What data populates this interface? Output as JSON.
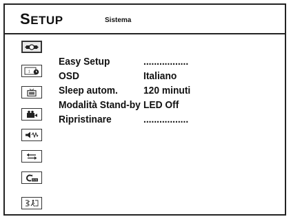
{
  "header": {
    "title_cap": "S",
    "title_rest": "ETUP",
    "subtitle": "Sistema"
  },
  "sidebar": {
    "items": [
      {
        "icon": "system-setup-icon",
        "selected": true
      },
      {
        "icon": "timer-icon",
        "selected": false
      },
      {
        "icon": "tv-icon",
        "selected": false
      },
      {
        "icon": "camera-icon",
        "selected": false
      },
      {
        "icon": "audio-icon",
        "selected": false
      },
      {
        "icon": "connection-icon",
        "selected": false
      },
      {
        "icon": "dvd-icon",
        "selected": false
      },
      {
        "icon": "exit-icon",
        "selected": false
      }
    ]
  },
  "menu": {
    "items": [
      {
        "label": "Easy Setup",
        "value": "................."
      },
      {
        "label": "OSD",
        "value": "Italiano"
      },
      {
        "label": "Sleep autom.",
        "value": "120 minuti"
      },
      {
        "label": "Modalità Stand-by",
        "value": "LED Off"
      },
      {
        "label": "Ripristinare",
        "value": "................."
      }
    ]
  }
}
